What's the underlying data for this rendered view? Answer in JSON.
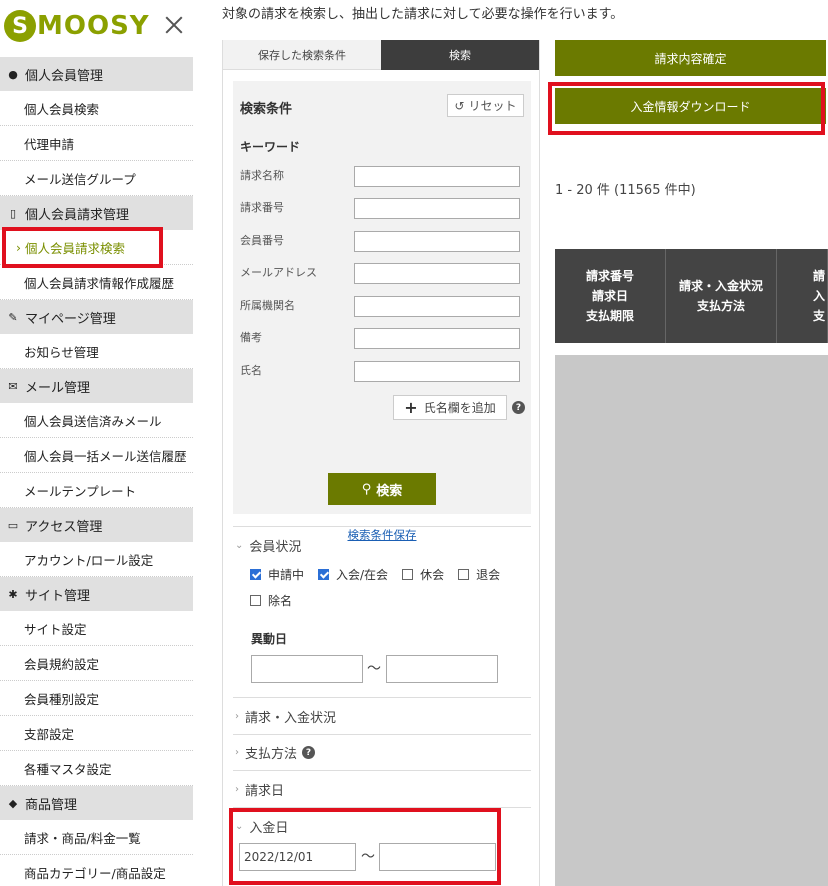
{
  "brand": {
    "logo_letter": "S",
    "logo_text": "MOOSY"
  },
  "page_description": "対象の請求を検索し、抽出した請求に対して必要な操作を行います。",
  "sidebar": {
    "sections": [
      {
        "title": "個人会員管理",
        "icon": "person-icon",
        "items": [
          "個人会員検索",
          "代理申請",
          "メール送信グループ"
        ]
      },
      {
        "title": "個人会員請求管理",
        "icon": "document-icon",
        "items": [
          "個人会員請求検索",
          "個人会員請求情報作成履歴"
        ]
      },
      {
        "title": "マイページ管理",
        "icon": "pencil-icon",
        "items": [
          "お知らせ管理"
        ]
      },
      {
        "title": "メール管理",
        "icon": "envelope-icon",
        "items": [
          "個人会員送信済みメール",
          "個人会員一括メール送信履歴",
          "メールテンプレート"
        ]
      },
      {
        "title": "アクセス管理",
        "icon": "monitor-icon",
        "items": [
          "アカウント/ロール設定"
        ]
      },
      {
        "title": "サイト管理",
        "icon": "gear-icon",
        "items": [
          "サイト設定",
          "会員規約設定",
          "会員種別設定",
          "支部設定",
          "各種マスタ設定"
        ]
      },
      {
        "title": "商品管理",
        "icon": "tag-icon",
        "items": [
          "請求・商品/料金一覧",
          "商品カテゴリー/商品設定"
        ]
      }
    ]
  },
  "search": {
    "tabs": [
      "保存した検索条件",
      "検索"
    ],
    "title": "検索条件",
    "reset_label": "リセット",
    "keyword_label": "キーワード",
    "fields": [
      "請求名称",
      "請求番号",
      "会員番号",
      "メールアドレス",
      "所属機関名",
      "備考",
      "氏名"
    ],
    "add_name_label": "氏名欄を追加",
    "search_button": "検索",
    "save_condition_link": "検索条件保存",
    "member_status": {
      "title": "会員状況",
      "options": [
        {
          "label": "申請中",
          "checked": true
        },
        {
          "label": "入会/在会",
          "checked": true
        },
        {
          "label": "休会",
          "checked": false
        },
        {
          "label": "退会",
          "checked": false
        },
        {
          "label": "除名",
          "checked": false
        }
      ],
      "change_date_label": "異動日",
      "tilde": "〜"
    },
    "collapsed_sections": [
      "請求・入金状況",
      "支払方法",
      "請求日"
    ],
    "payment_date": {
      "title": "入金日",
      "from": "2022/12/01",
      "to": "",
      "tilde": "〜"
    }
  },
  "actions": {
    "confirm_label": "請求内容確定",
    "download_label": "入金情報ダウンロード"
  },
  "results": {
    "count_text": "1 - 20 件 (11565 件中)",
    "columns": [
      [
        "請求番号",
        "請求日",
        "支払期限"
      ],
      [
        "請求・入金状況",
        "支払方法"
      ],
      [
        "請",
        "入",
        "支"
      ]
    ]
  }
}
